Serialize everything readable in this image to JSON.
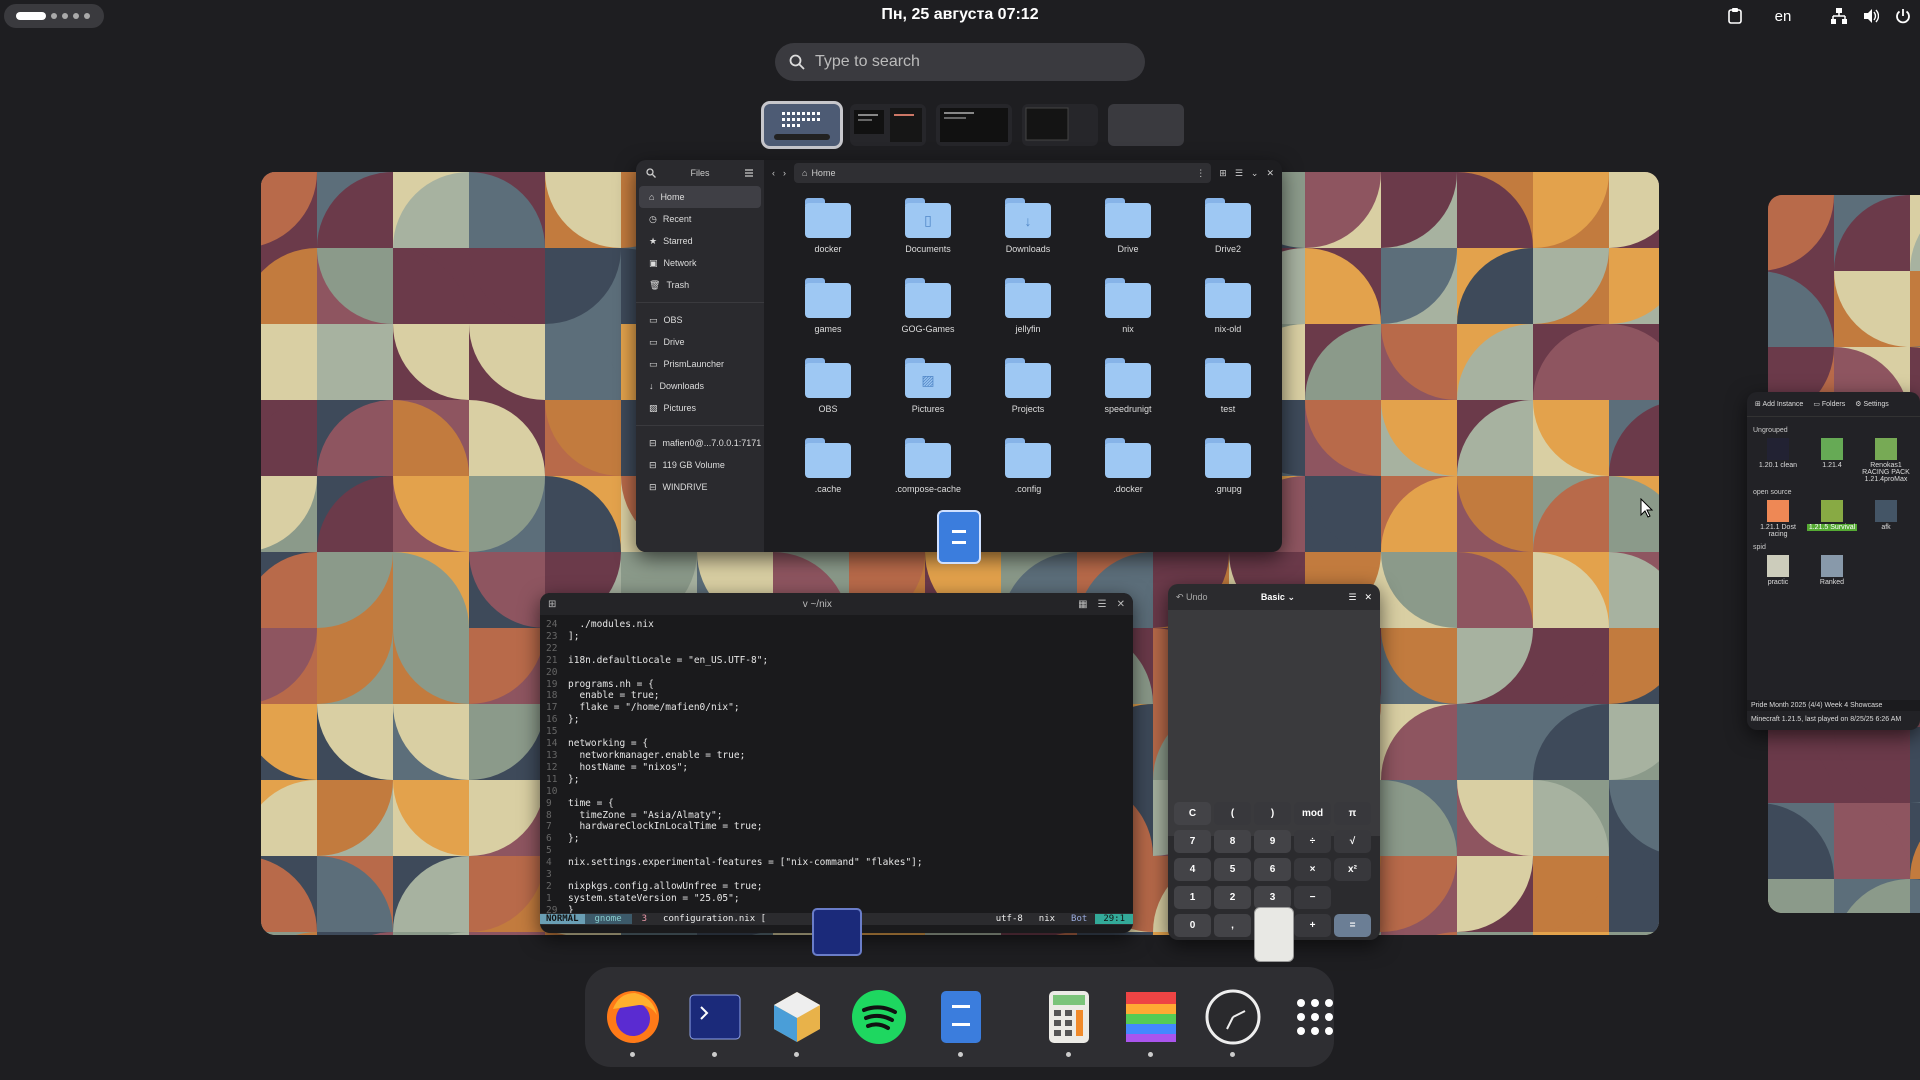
{
  "topbar": {
    "clock": "Пн, 25 августа  07:12",
    "lang": "en",
    "icons": [
      "clipboard-icon",
      "network-icon",
      "volume-icon",
      "power-icon"
    ]
  },
  "search": {
    "placeholder": "Type to search"
  },
  "files": {
    "sidebar_title": "Files",
    "places": [
      "Home",
      "Recent",
      "Starred",
      "Network",
      "Trash"
    ],
    "bookmarks": [
      "OBS",
      "Drive",
      "PrismLauncher",
      "Downloads",
      "Pictures"
    ],
    "devices": [
      "mafien0@...7.0.0.1:7171",
      "119 GB Volume",
      "WINDRIVE"
    ],
    "path": "Home",
    "folders": [
      "docker",
      "Documents",
      "Downloads",
      "Drive",
      "Drive2",
      "games",
      "GOG-Games",
      "jellyfin",
      "nix",
      "nix-old",
      "OBS",
      "Pictures",
      "Projects",
      "speedrunigt",
      "test",
      ".cache",
      ".compose-cache",
      ".config",
      ".docker",
      ".gnupg"
    ]
  },
  "terminal": {
    "title": "v ~/nix",
    "lines": [
      {
        "n": "24",
        "t": "  ./modules.nix"
      },
      {
        "n": "23",
        "t": "];"
      },
      {
        "n": "22",
        "t": ""
      },
      {
        "n": "21",
        "t": "i18n.defaultLocale = \"en_US.UTF-8\";"
      },
      {
        "n": "20",
        "t": ""
      },
      {
        "n": "19",
        "t": "programs.nh = {"
      },
      {
        "n": "18",
        "t": "  enable = true;"
      },
      {
        "n": "17",
        "t": "  flake = \"/home/mafien0/nix\";"
      },
      {
        "n": "16",
        "t": "};"
      },
      {
        "n": "15",
        "t": ""
      },
      {
        "n": "14",
        "t": "networking = {"
      },
      {
        "n": "13",
        "t": "  networkmanager.enable = true;"
      },
      {
        "n": "12",
        "t": "  hostName = \"nixos\";"
      },
      {
        "n": "11",
        "t": "};"
      },
      {
        "n": "10",
        "t": ""
      },
      {
        "n": "9",
        "t": "time = {"
      },
      {
        "n": "8",
        "t": "  timeZone = \"Asia/Almaty\";"
      },
      {
        "n": "7",
        "t": "  hardwareClockInLocalTime = true;"
      },
      {
        "n": "6",
        "t": "};"
      },
      {
        "n": "5",
        "t": ""
      },
      {
        "n": "4",
        "t": "nix.settings.experimental-features = [\"nix-command\" \"flakes\"];"
      },
      {
        "n": "3",
        "t": ""
      },
      {
        "n": "2",
        "t": "nixpkgs.config.allowUnfree = true;"
      },
      {
        "n": "1",
        "t": "system.stateVersion = \"25.05\";"
      },
      {
        "n": "29",
        "t": "}"
      }
    ],
    "status": {
      "mode": "NORMAL",
      "branch": "gnome",
      "warn": "3",
      "file": "configuration.nix [",
      "enc": "utf-8",
      "ft": "nix",
      "pos_label": "Bot",
      "pos": "29:1"
    }
  },
  "calculator": {
    "undo": "Undo",
    "mode": "Basic",
    "keys": [
      "C",
      "(",
      ")",
      "mod",
      "π",
      "7",
      "8",
      "9",
      "÷",
      "√",
      "4",
      "5",
      "6",
      "×",
      "x²",
      "1",
      "2",
      "3",
      "−",
      "",
      "0",
      ",",
      "%",
      "+",
      "="
    ]
  },
  "prism": {
    "toolbar": [
      "Add Instance",
      "Folders",
      "Settings"
    ],
    "groups": [
      {
        "name": "Ungrouped",
        "items": [
          "1.20.1 clean",
          "1.21.4",
          "Renokas1 RACING PACK 1.21.4proMax"
        ]
      },
      {
        "name": "open source",
        "items": [
          "1.21.1 Dost racing",
          "1.21.5 Survival",
          "afk"
        ]
      },
      {
        "name": "spid",
        "items": [
          "practic",
          "Ranked"
        ]
      }
    ],
    "news": "Pride Month 2025 (4/4) Week 4 Showcase",
    "status": "Minecraft 1.21.5, last played on 8/25/25 6:26 AM"
  },
  "dock": [
    "firefox",
    "terminal",
    "blender",
    "spotify",
    "files",
    "calculator",
    "prism-launcher",
    "clock",
    "app-grid"
  ]
}
